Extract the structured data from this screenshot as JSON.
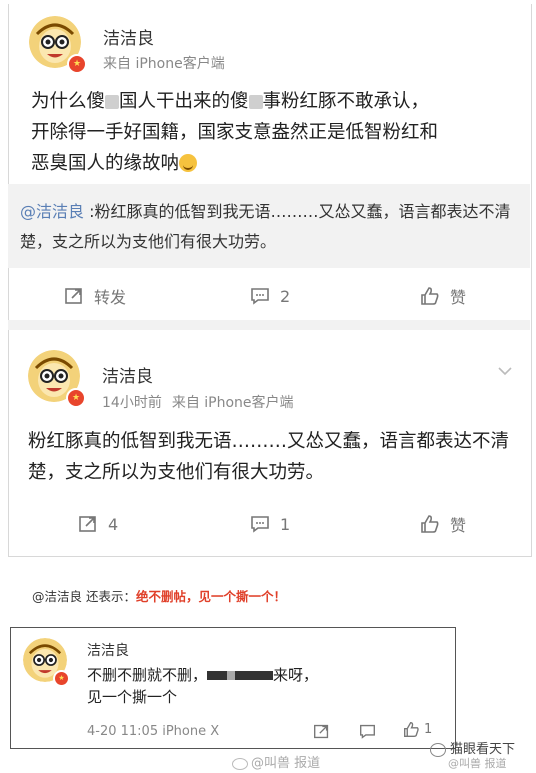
{
  "post1": {
    "username": "洁洁良",
    "meta": "来自 iPhone客户端",
    "text_line1_a": "为什么傻",
    "text_line1_b": "国人干出来的傻",
    "text_line1_c": "事粉红豚不敢承认，",
    "text_line2": "开除得一手好国籍，国家支意盎然正是低智粉红和",
    "text_line3": "恶臭国人的缘故呐",
    "quote_mention": "@洁洁良",
    "quote_text": " :粉红豚真的低智到我无语………又怂又蠢，语言都表达不清楚，支之所以为支他们有很大功劳。",
    "actions": {
      "repost_label": "转发",
      "comment_count": "2",
      "like_label": "赞"
    }
  },
  "post2": {
    "username": "洁洁良",
    "time": "14小时前",
    "source": "来自 iPhone客户端",
    "text": "粉红豚真的低智到我无语………又怂又蠢，语言都表达不清楚，支之所以为支他们有很大功劳。",
    "actions": {
      "repost_count": "4",
      "comment_count": "1",
      "like_label": "赞"
    }
  },
  "note": {
    "prefix": "@洁洁良 还表示：",
    "highlight": "绝不删帖，见一个撕一个！"
  },
  "post3": {
    "username": "洁洁良",
    "line1_a": "不删不删就不删，",
    "line1_b": "来呀，",
    "line2": "见一个撕一个",
    "meta": "4-20 11:05 iPhone X",
    "like_count": "1"
  },
  "watermark": {
    "center": "@叫兽 报道",
    "right_text": "猫眼看天下",
    "right_sub": "@叫兽 报道"
  },
  "colors": {
    "mention_blue": "#5a7fb5",
    "highlight_red": "#e0402a",
    "badge_red": "#e8452c",
    "quote_bg": "#f2f2f2"
  }
}
